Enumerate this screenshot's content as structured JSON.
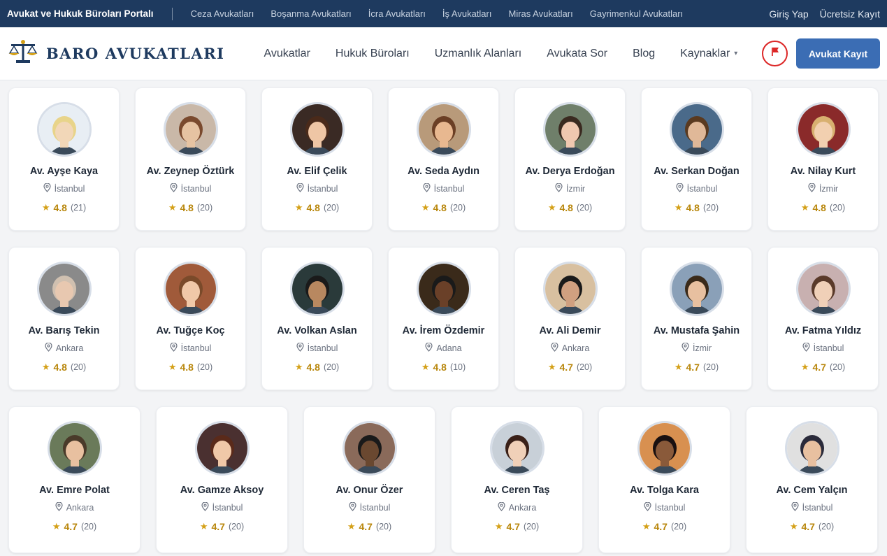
{
  "topbar": {
    "portal": "Avukat ve Hukuk Büroları Portalı",
    "links": [
      "Ceza Avukatları",
      "Boşanma Avukatları",
      "İcra Avukatları",
      "İş Avukatları",
      "Miras Avukatları",
      "Gayrimenkul Avukatları"
    ],
    "login": "Giriş Yap",
    "signup": "Ücretsiz Kayıt"
  },
  "header": {
    "logo": "BARO AVUKATLARI",
    "nav": [
      "Avukatlar",
      "Hukuk Büroları",
      "Uzmanlık Alanları",
      "Avukata Sor",
      "Blog",
      "Kaynaklar"
    ],
    "register": "Avukat Kayıt"
  },
  "colors": {
    "topbar": "#1e3a5f",
    "brand": "#1e3a5f",
    "button": "#3b6db4",
    "flag": "#dc2626",
    "star": "#d4a017"
  },
  "lawyers": [
    {
      "name": "Av. Ayşe Kaya",
      "city": "İstanbul",
      "rating": "4.8",
      "count": "(21)"
    },
    {
      "name": "Av. Zeynep Öztürk",
      "city": "İstanbul",
      "rating": "4.8",
      "count": "(20)"
    },
    {
      "name": "Av. Elif Çelik",
      "city": "İstanbul",
      "rating": "4.8",
      "count": "(20)"
    },
    {
      "name": "Av. Seda Aydın",
      "city": "İstanbul",
      "rating": "4.8",
      "count": "(20)"
    },
    {
      "name": "Av. Derya Erdoğan",
      "city": "İzmir",
      "rating": "4.8",
      "count": "(20)"
    },
    {
      "name": "Av. Serkan Doğan",
      "city": "İstanbul",
      "rating": "4.8",
      "count": "(20)"
    },
    {
      "name": "Av. Nilay Kurt",
      "city": "İzmir",
      "rating": "4.8",
      "count": "(20)"
    },
    {
      "name": "Av. Barış Tekin",
      "city": "Ankara",
      "rating": "4.8",
      "count": "(20)"
    },
    {
      "name": "Av. Tuğçe Koç",
      "city": "İstanbul",
      "rating": "4.8",
      "count": "(20)"
    },
    {
      "name": "Av. Volkan Aslan",
      "city": "İstanbul",
      "rating": "4.8",
      "count": "(20)"
    },
    {
      "name": "Av. İrem Özdemir",
      "city": "Adana",
      "rating": "4.8",
      "count": "(10)"
    },
    {
      "name": "Av. Ali Demir",
      "city": "Ankara",
      "rating": "4.7",
      "count": "(20)"
    },
    {
      "name": "Av. Mustafa Şahin",
      "city": "İzmir",
      "rating": "4.7",
      "count": "(20)"
    },
    {
      "name": "Av. Fatma Yıldız",
      "city": "İstanbul",
      "rating": "4.7",
      "count": "(20)"
    },
    {
      "name": "Av. Emre Polat",
      "city": "Ankara",
      "rating": "4.7",
      "count": "(20)"
    },
    {
      "name": "Av. Gamze Aksoy",
      "city": "İstanbul",
      "rating": "4.7",
      "count": "(20)"
    },
    {
      "name": "Av. Onur Özer",
      "city": "İstanbul",
      "rating": "4.7",
      "count": "(20)"
    },
    {
      "name": "Av. Ceren Taş",
      "city": "Ankara",
      "rating": "4.7",
      "count": "(20)"
    },
    {
      "name": "Av. Tolga Kara",
      "city": "İstanbul",
      "rating": "4.7",
      "count": "(20)"
    },
    {
      "name": "Av. Cem Yalçın",
      "city": "İstanbul",
      "rating": "4.7",
      "count": "(20)"
    }
  ]
}
